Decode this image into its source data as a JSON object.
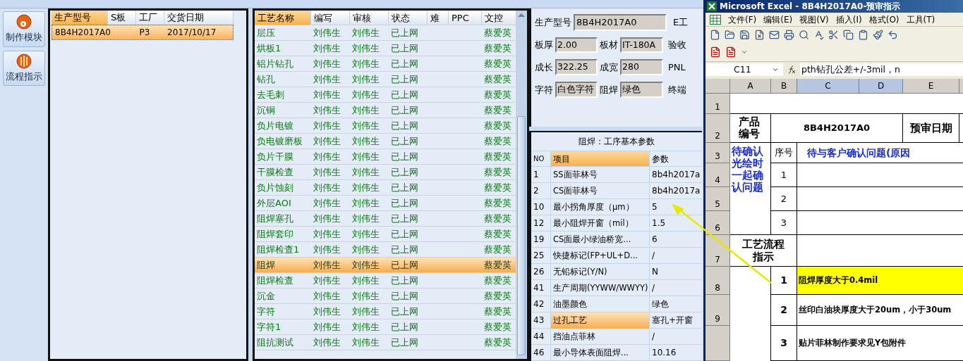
{
  "sidebar": {
    "buttons": [
      {
        "label": "制作模块",
        "kind": "disc"
      },
      {
        "label": "流程指示",
        "kind": "striped"
      }
    ]
  },
  "orders": {
    "columns": [
      {
        "label": "生产型号",
        "sorted": true
      },
      {
        "label": "S板",
        "sorted": false
      },
      {
        "label": "工厂",
        "sorted": false
      },
      {
        "label": "交货日期",
        "sorted": false
      }
    ],
    "rows": [
      {
        "model": "8B4H2017A0",
        "factory": "P3",
        "due": "2017/10/17",
        "selected": true
      }
    ]
  },
  "processes": {
    "columns": [
      {
        "label": "工艺名称",
        "sorted": true
      },
      {
        "label": "编写",
        "sorted": false
      },
      {
        "label": "审核",
        "sorted": false
      },
      {
        "label": "状态",
        "sorted": false
      },
      {
        "label": "难",
        "sorted": false
      },
      {
        "label": "PPC",
        "sorted": false
      },
      {
        "label": "文控",
        "sorted": false
      }
    ],
    "rows": [
      {
        "name": "层压",
        "author": "刘伟生",
        "reviewer": "刘伟生",
        "status": "已上网",
        "controller": "蔡爱英",
        "selected": false
      },
      {
        "name": "烘板1",
        "author": "刘伟生",
        "reviewer": "刘伟生",
        "status": "已上网",
        "controller": "蔡爱英",
        "selected": false
      },
      {
        "name": "铝片钻孔",
        "author": "刘伟生",
        "reviewer": "刘伟生",
        "status": "已上网",
        "controller": "蔡爱英",
        "selected": false
      },
      {
        "name": "钻孔",
        "author": "刘伟生",
        "reviewer": "刘伟生",
        "status": "已上网",
        "controller": "蔡爱英",
        "selected": false
      },
      {
        "name": "去毛刺",
        "author": "刘伟生",
        "reviewer": "刘伟生",
        "status": "已上网",
        "controller": "蔡爱英",
        "selected": false
      },
      {
        "name": "沉铜",
        "author": "刘伟生",
        "reviewer": "刘伟生",
        "status": "已上网",
        "controller": "蔡爱英",
        "selected": false
      },
      {
        "name": "负片电镀",
        "author": "刘伟生",
        "reviewer": "刘伟生",
        "status": "已上网",
        "controller": "蔡爱英",
        "selected": false
      },
      {
        "name": "负电镀磨板",
        "author": "刘伟生",
        "reviewer": "刘伟生",
        "status": "已上网",
        "controller": "蔡爱英",
        "selected": false
      },
      {
        "name": "负片干膜",
        "author": "刘伟生",
        "reviewer": "刘伟生",
        "status": "已上网",
        "controller": "蔡爱英",
        "selected": false
      },
      {
        "name": "干膜检查",
        "author": "刘伟生",
        "reviewer": "刘伟生",
        "status": "已上网",
        "controller": "蔡爱英",
        "selected": false
      },
      {
        "name": "负片蚀刻",
        "author": "刘伟生",
        "reviewer": "刘伟生",
        "status": "已上网",
        "controller": "蔡爱英",
        "selected": false
      },
      {
        "name": "外层AOI",
        "author": "刘伟生",
        "reviewer": "刘伟生",
        "status": "已上网",
        "controller": "蔡爱英",
        "selected": false
      },
      {
        "name": "阻焊塞孔",
        "author": "刘伟生",
        "reviewer": "刘伟生",
        "status": "已上网",
        "controller": "蔡爱英",
        "selected": false
      },
      {
        "name": "阻焊套印",
        "author": "刘伟生",
        "reviewer": "刘伟生",
        "status": "已上网",
        "controller": "蔡爱英",
        "selected": false
      },
      {
        "name": "阻焊检查1",
        "author": "刘伟生",
        "reviewer": "刘伟生",
        "status": "已上网",
        "controller": "蔡爱英",
        "selected": false
      },
      {
        "name": "阻焊",
        "author": "刘伟生",
        "reviewer": "刘伟生",
        "status": "已上网",
        "controller": "蔡爱英",
        "selected": true
      },
      {
        "name": "阻焊检查",
        "author": "刘伟生",
        "reviewer": "刘伟生",
        "status": "已上网",
        "controller": "蔡爱英",
        "selected": false
      },
      {
        "name": "沉金",
        "author": "刘伟生",
        "reviewer": "刘伟生",
        "status": "已上网",
        "controller": "蔡爱英",
        "selected": false
      },
      {
        "name": "字符",
        "author": "刘伟生",
        "reviewer": "刘伟生",
        "status": "已上网",
        "controller": "蔡爱英",
        "selected": false
      },
      {
        "name": "字符1",
        "author": "刘伟生",
        "reviewer": "刘伟生",
        "status": "已上网",
        "controller": "蔡爱英",
        "selected": false
      },
      {
        "name": "阻抗测试",
        "author": "刘伟生",
        "reviewer": "刘伟生",
        "status": "已上网",
        "controller": "蔡爱英",
        "selected": false
      }
    ]
  },
  "order_info": {
    "model_label": "生产型号",
    "model_value": "8B4H2017A0",
    "model_trailing": "E工",
    "rows": [
      {
        "fields": [
          {
            "label": "板厚",
            "value": "2.00"
          },
          {
            "label": "板材",
            "value": "IT-180A"
          }
        ],
        "trailing": "验收"
      },
      {
        "fields": [
          {
            "label": "成长",
            "value": "322.25"
          },
          {
            "label": "成宽",
            "value": "280"
          }
        ],
        "trailing": "PNL"
      },
      {
        "fields": [
          {
            "label": "字符",
            "value": "白色字符"
          },
          {
            "label": "阻焊",
            "value": "绿色"
          }
        ],
        "trailing": "终端"
      }
    ]
  },
  "params": {
    "title": "阻焊：工序基本参数",
    "columns": [
      {
        "label": "NO",
        "sorted": false
      },
      {
        "label": "项目",
        "sorted": true
      },
      {
        "label": "参数",
        "sorted": false
      }
    ],
    "rows": [
      {
        "no": "1",
        "item": "SS面菲林号",
        "value": "8b4h2017a",
        "selected": false
      },
      {
        "no": "2",
        "item": "CS面菲林号",
        "value": "8b4h2017a",
        "selected": false
      },
      {
        "no": "10",
        "item": "最小拐角厚度（μm）",
        "value": "5",
        "selected": false
      },
      {
        "no": "12",
        "item": "最小阻焊开窗（mil）",
        "value": "1.5",
        "selected": false
      },
      {
        "no": "19",
        "item": "CS面最小绿油桥宽...",
        "value": "6",
        "selected": false
      },
      {
        "no": "25",
        "item": "快捷标记(FP+UL+D...",
        "value": "/",
        "selected": false
      },
      {
        "no": "26",
        "item": "无铅标记(Y/N)",
        "value": "N",
        "selected": false
      },
      {
        "no": "41",
        "item": "生产周期(YYWW/WWYY)",
        "value": "/",
        "selected": false
      },
      {
        "no": "42",
        "item": "油墨颜色",
        "value": "绿色",
        "selected": false
      },
      {
        "no": "43",
        "item": "过孔工艺",
        "value": "塞孔+开窗",
        "selected": true
      },
      {
        "no": "44",
        "item": "挡油点菲林",
        "value": "/",
        "selected": false
      },
      {
        "no": "46",
        "item": "最小导体表面阻焊...",
        "value": "10.16",
        "selected": false
      }
    ]
  },
  "excel": {
    "title": "Microsoft Excel - 8B4H2017A0-预审指示",
    "menu": [
      "文件(F)",
      "编辑(E)",
      "视图(V)",
      "插入(I)",
      "格式(O)",
      "工具(T)"
    ],
    "name_box": "C11",
    "formula": "pth钻孔公差+/-3mil，n",
    "columns": [
      {
        "label": "A",
        "selected": false
      },
      {
        "label": "B",
        "selected": false
      },
      {
        "label": "C",
        "selected": true
      },
      {
        "label": "D",
        "selected": true
      },
      {
        "label": "E",
        "selected": false
      }
    ],
    "row_numbers": [
      "1",
      "2",
      "3",
      "4",
      "5",
      "6",
      "7",
      "8",
      "9"
    ],
    "product_label": "产品编号",
    "product_code": "8B4H2017A0",
    "review_date_label": "预审日期",
    "seq_label": "序号",
    "question_header": "待与客户确认问题(原因",
    "confirm_label": "待确认光绘时一起确认问题",
    "question_numbers": [
      "1",
      "2",
      "3"
    ],
    "flow_label": "工艺流程指示",
    "instructions": [
      {
        "no": "1",
        "text": "阻焊厚度大于0.4mil",
        "highlighted": true
      },
      {
        "no": "2",
        "text": "丝印白油块厚度大于20um，小于30um",
        "highlighted": false
      },
      {
        "no": "3",
        "text": "贴片菲林制作要求见Y包附件",
        "highlighted": false
      }
    ]
  }
}
